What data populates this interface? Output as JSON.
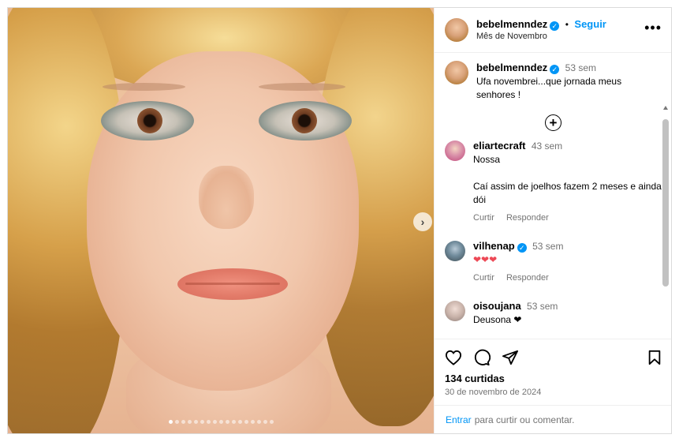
{
  "post": {
    "author": "bebelmenndez",
    "verified": true,
    "separator": "•",
    "follow_label": "Seguir",
    "subtitle": "Mês de Novembro",
    "more_label": "•••"
  },
  "media": {
    "description": "photo",
    "next_arrow": "›",
    "dots_count": 17,
    "active_dot": 0
  },
  "caption": {
    "author": "bebelmenndez",
    "time": "53 sem",
    "text": "Ufa novembrei...que jornada meus senhores !"
  },
  "load_more_label": "+",
  "comments": [
    {
      "author": "eliartecraft",
      "verified": false,
      "time": "43 sem",
      "line1": "Nossa",
      "line2": "Caí assim de joelhos fazem 2 meses e ainda dói",
      "like_label": "Curtir",
      "reply_label": "Responder"
    },
    {
      "author": "vilhenap",
      "verified": true,
      "time": "53 sem",
      "line1": "❤❤❤",
      "like_label": "Curtir",
      "reply_label": "Responder"
    },
    {
      "author": "oisoujana",
      "verified": false,
      "time": "53 sem",
      "line1": "Deusona ❤"
    }
  ],
  "likes_text": "134 curtidas",
  "date_text": "30 de novembro de 2024",
  "login": {
    "link": "Entrar",
    "text": "para curtir ou comentar."
  },
  "colors": {
    "accent": "#0095f6",
    "heart": "#ed4956",
    "muted": "#737373"
  }
}
